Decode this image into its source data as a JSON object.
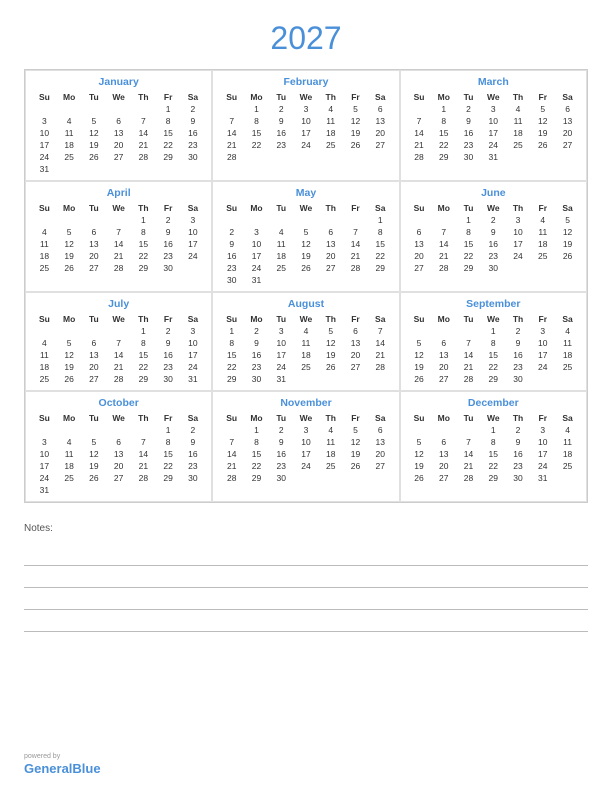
{
  "title": "2027",
  "months": [
    {
      "name": "January",
      "weeks": [
        [
          "",
          "",
          "",
          "",
          "",
          "1",
          "2"
        ],
        [
          "3",
          "4",
          "5",
          "6",
          "7",
          "8",
          "9"
        ],
        [
          "10",
          "11",
          "12",
          "13",
          "14",
          "15",
          "16"
        ],
        [
          "17",
          "18",
          "19",
          "20",
          "21",
          "22",
          "23"
        ],
        [
          "24",
          "25",
          "26",
          "27",
          "28",
          "29",
          "30"
        ],
        [
          "31",
          "",
          "",
          "",
          "",
          "",
          ""
        ]
      ]
    },
    {
      "name": "February",
      "weeks": [
        [
          "",
          "1",
          "2",
          "3",
          "4",
          "5",
          "6"
        ],
        [
          "7",
          "8",
          "9",
          "10",
          "11",
          "12",
          "13"
        ],
        [
          "14",
          "15",
          "16",
          "17",
          "18",
          "19",
          "20"
        ],
        [
          "21",
          "22",
          "23",
          "24",
          "25",
          "26",
          "27"
        ],
        [
          "28",
          "",
          "",
          "",
          "",
          "",
          ""
        ]
      ]
    },
    {
      "name": "March",
      "weeks": [
        [
          "",
          "1",
          "2",
          "3",
          "4",
          "5",
          "6"
        ],
        [
          "7",
          "8",
          "9",
          "10",
          "11",
          "12",
          "13"
        ],
        [
          "14",
          "15",
          "16",
          "17",
          "18",
          "19",
          "20"
        ],
        [
          "21",
          "22",
          "23",
          "24",
          "25",
          "26",
          "27"
        ],
        [
          "28",
          "29",
          "30",
          "31",
          "",
          "",
          ""
        ]
      ]
    },
    {
      "name": "April",
      "weeks": [
        [
          "",
          "",
          "",
          "",
          "1",
          "2",
          "3"
        ],
        [
          "4",
          "5",
          "6",
          "7",
          "8",
          "9",
          "10"
        ],
        [
          "11",
          "12",
          "13",
          "14",
          "15",
          "16",
          "17"
        ],
        [
          "18",
          "19",
          "20",
          "21",
          "22",
          "23",
          "24"
        ],
        [
          "25",
          "26",
          "27",
          "28",
          "29",
          "30",
          ""
        ]
      ]
    },
    {
      "name": "May",
      "weeks": [
        [
          "",
          "",
          "",
          "",
          "",
          "",
          "1"
        ],
        [
          "2",
          "3",
          "4",
          "5",
          "6",
          "7",
          "8"
        ],
        [
          "9",
          "10",
          "11",
          "12",
          "13",
          "14",
          "15"
        ],
        [
          "16",
          "17",
          "18",
          "19",
          "20",
          "21",
          "22"
        ],
        [
          "23",
          "24",
          "25",
          "26",
          "27",
          "28",
          "29"
        ],
        [
          "30",
          "31",
          "",
          "",
          "",
          "",
          ""
        ]
      ]
    },
    {
      "name": "June",
      "weeks": [
        [
          "",
          "",
          "1",
          "2",
          "3",
          "4",
          "5"
        ],
        [
          "6",
          "7",
          "8",
          "9",
          "10",
          "11",
          "12"
        ],
        [
          "13",
          "14",
          "15",
          "16",
          "17",
          "18",
          "19"
        ],
        [
          "20",
          "21",
          "22",
          "23",
          "24",
          "25",
          "26"
        ],
        [
          "27",
          "28",
          "29",
          "30",
          "",
          "",
          ""
        ]
      ]
    },
    {
      "name": "July",
      "weeks": [
        [
          "",
          "",
          "",
          "",
          "1",
          "2",
          "3"
        ],
        [
          "4",
          "5",
          "6",
          "7",
          "8",
          "9",
          "10"
        ],
        [
          "11",
          "12",
          "13",
          "14",
          "15",
          "16",
          "17"
        ],
        [
          "18",
          "19",
          "20",
          "21",
          "22",
          "23",
          "24"
        ],
        [
          "25",
          "26",
          "27",
          "28",
          "29",
          "30",
          "31"
        ]
      ]
    },
    {
      "name": "August",
      "weeks": [
        [
          "1",
          "2",
          "3",
          "4",
          "5",
          "6",
          "7"
        ],
        [
          "8",
          "9",
          "10",
          "11",
          "12",
          "13",
          "14"
        ],
        [
          "15",
          "16",
          "17",
          "18",
          "19",
          "20",
          "21"
        ],
        [
          "22",
          "23",
          "24",
          "25",
          "26",
          "27",
          "28"
        ],
        [
          "29",
          "30",
          "31",
          "",
          "",
          "",
          ""
        ]
      ]
    },
    {
      "name": "September",
      "weeks": [
        [
          "",
          "",
          "",
          "1",
          "2",
          "3",
          "4"
        ],
        [
          "5",
          "6",
          "7",
          "8",
          "9",
          "10",
          "11"
        ],
        [
          "12",
          "13",
          "14",
          "15",
          "16",
          "17",
          "18"
        ],
        [
          "19",
          "20",
          "21",
          "22",
          "23",
          "24",
          "25"
        ],
        [
          "26",
          "27",
          "28",
          "29",
          "30",
          "",
          ""
        ]
      ]
    },
    {
      "name": "October",
      "weeks": [
        [
          "",
          "",
          "",
          "",
          "",
          "1",
          "2"
        ],
        [
          "3",
          "4",
          "5",
          "6",
          "7",
          "8",
          "9"
        ],
        [
          "10",
          "11",
          "12",
          "13",
          "14",
          "15",
          "16"
        ],
        [
          "17",
          "18",
          "19",
          "20",
          "21",
          "22",
          "23"
        ],
        [
          "24",
          "25",
          "26",
          "27",
          "28",
          "29",
          "30"
        ],
        [
          "31",
          "",
          "",
          "",
          "",
          "",
          ""
        ]
      ]
    },
    {
      "name": "November",
      "weeks": [
        [
          "",
          "1",
          "2",
          "3",
          "4",
          "5",
          "6"
        ],
        [
          "7",
          "8",
          "9",
          "10",
          "11",
          "12",
          "13"
        ],
        [
          "14",
          "15",
          "16",
          "17",
          "18",
          "19",
          "20"
        ],
        [
          "21",
          "22",
          "23",
          "24",
          "25",
          "26",
          "27"
        ],
        [
          "28",
          "29",
          "30",
          "",
          "",
          "",
          ""
        ]
      ]
    },
    {
      "name": "December",
      "weeks": [
        [
          "",
          "",
          "",
          "1",
          "2",
          "3",
          "4"
        ],
        [
          "5",
          "6",
          "7",
          "8",
          "9",
          "10",
          "11"
        ],
        [
          "12",
          "13",
          "14",
          "15",
          "16",
          "17",
          "18"
        ],
        [
          "19",
          "20",
          "21",
          "22",
          "23",
          "24",
          "25"
        ],
        [
          "26",
          "27",
          "28",
          "29",
          "30",
          "31",
          ""
        ]
      ]
    }
  ],
  "dayHeaders": [
    "Su",
    "Mo",
    "Tu",
    "We",
    "Th",
    "Fr",
    "Sa"
  ],
  "notes": {
    "label": "Notes:",
    "lines": 4
  },
  "footer": {
    "powered_by": "powered by",
    "brand_black": "General",
    "brand_blue": "Blue"
  }
}
